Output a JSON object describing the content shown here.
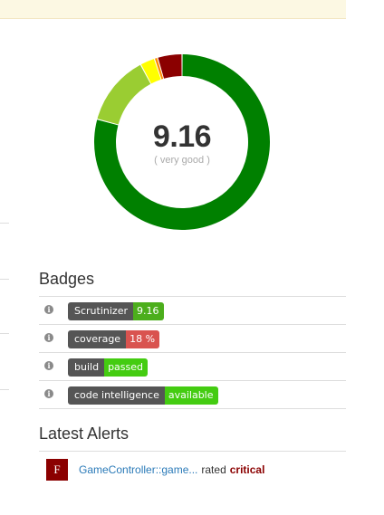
{
  "quality": {
    "score": "9.16",
    "rating": "( very good )",
    "distribution": [
      {
        "grade": "very-good",
        "value": 79.2,
        "color": "#008000"
      },
      {
        "grade": "good",
        "value": 13.0,
        "color": "#9acd32"
      },
      {
        "grade": "satisfactory",
        "value": 2.7,
        "color": "#ffff00"
      },
      {
        "grade": "pass",
        "value": 0.6,
        "color": "#ff8c00"
      },
      {
        "grade": "critical",
        "value": 4.5,
        "color": "#8b0000"
      }
    ]
  },
  "badges": {
    "title": "Badges",
    "items": [
      {
        "label": "Scrutinizer",
        "value": "9.16",
        "color": "#4cae1c"
      },
      {
        "label": "coverage",
        "value": "18 %",
        "color": "#d9534f"
      },
      {
        "label": "build",
        "value": "passed",
        "color": "#44cc11"
      },
      {
        "label": "code intelligence",
        "value": "available",
        "color": "#44cc11"
      }
    ],
    "info_glyph": "i"
  },
  "alerts": {
    "title": "Latest Alerts",
    "items": [
      {
        "grade": "F",
        "link": "GameController::game...",
        "rated": "rated",
        "severity": "critical"
      }
    ]
  },
  "icons": {
    "info": "info-circle-icon"
  }
}
